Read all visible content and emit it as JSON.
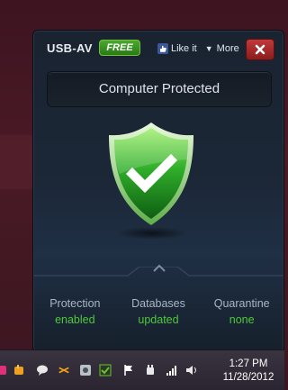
{
  "widget": {
    "title": "USB-AV",
    "badge": "FREE",
    "like_label": "Like it",
    "more_label": "More",
    "status": "Computer Protected"
  },
  "stats": [
    {
      "label": "Protection",
      "value": "enabled"
    },
    {
      "label": "Databases",
      "value": "updated"
    },
    {
      "label": "Quarantine",
      "value": "none"
    }
  ],
  "taskbar": {
    "time": "1:27 PM",
    "date": "11/28/2012"
  },
  "colors": {
    "status_green": "#4fc83a",
    "badge_green": "#3a8f22",
    "close_red": "#b83032",
    "panel_bg": "#1b2737"
  },
  "icons": [
    "facebook-like-icon",
    "close-icon",
    "shield-check-icon",
    "chevron-up-icon"
  ]
}
